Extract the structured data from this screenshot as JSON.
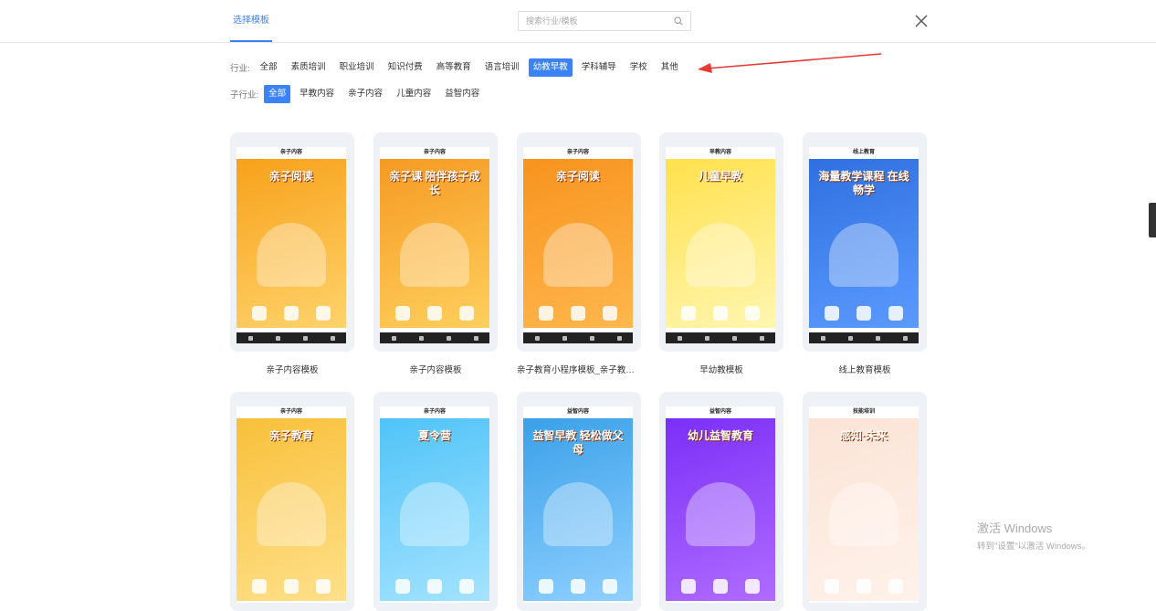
{
  "header": {
    "active_tab": "选择模板",
    "search_placeholder": "搜索行业/模板"
  },
  "filters": {
    "industry_label": "行业:",
    "industries": [
      "全部",
      "素质培训",
      "职业培训",
      "知识付费",
      "高等教育",
      "语言培训",
      "幼教早教",
      "学科辅导",
      "学校",
      "其他"
    ],
    "industry_active": "幼教早教",
    "sub_label": "子行业:",
    "subs": [
      "全部",
      "早教内容",
      "亲子内容",
      "儿童内容",
      "益智内容"
    ],
    "sub_active": "全部"
  },
  "templates": [
    {
      "header": "亲子内容",
      "title": "亲子内容模板",
      "poster_text": "亲子阅读",
      "colors": [
        "#f7a11a",
        "#ffd36b"
      ]
    },
    {
      "header": "亲子内容",
      "title": "亲子内容模板",
      "poster_text": "亲子课 陪伴孩子成长",
      "colors": [
        "#f59a23",
        "#ffcf5c"
      ]
    },
    {
      "header": "亲子内容",
      "title": "亲子教育小程序模板_亲子教育微...",
      "poster_text": "亲子阅读",
      "colors": [
        "#f7931e",
        "#ffb74d"
      ]
    },
    {
      "header": "早教内容",
      "title": "早幼教模板",
      "poster_text": "儿童早教",
      "colors": [
        "#ffe14d",
        "#fff6b0"
      ]
    },
    {
      "header": "线上教育",
      "title": "线上教育模板",
      "poster_text": "海量教学课程 在线畅学",
      "colors": [
        "#2f6fe0",
        "#5b9bff"
      ]
    },
    {
      "header": "亲子内容",
      "title": "",
      "poster_text": "亲子教育",
      "colors": [
        "#f8c03a",
        "#ffe08a"
      ]
    },
    {
      "header": "亲子内容",
      "title": "",
      "poster_text": "夏令营",
      "colors": [
        "#4fc3f7",
        "#a5e3ff"
      ]
    },
    {
      "header": "益智内容",
      "title": "",
      "poster_text": "益智早教 轻松做父母",
      "colors": [
        "#3aa0e8",
        "#8fd0ff"
      ]
    },
    {
      "header": "益智内容",
      "title": "",
      "poster_text": "幼儿益智教育",
      "colors": [
        "#7b2ff7",
        "#b06cff"
      ]
    },
    {
      "header": "技能培训",
      "title": "",
      "poster_text": "感知·未来",
      "colors": [
        "#fbe3d6",
        "#fff2ea"
      ]
    }
  ],
  "watermark": {
    "line1": "激活 Windows",
    "line2": "转到\"设置\"以激活 Windows。"
  }
}
